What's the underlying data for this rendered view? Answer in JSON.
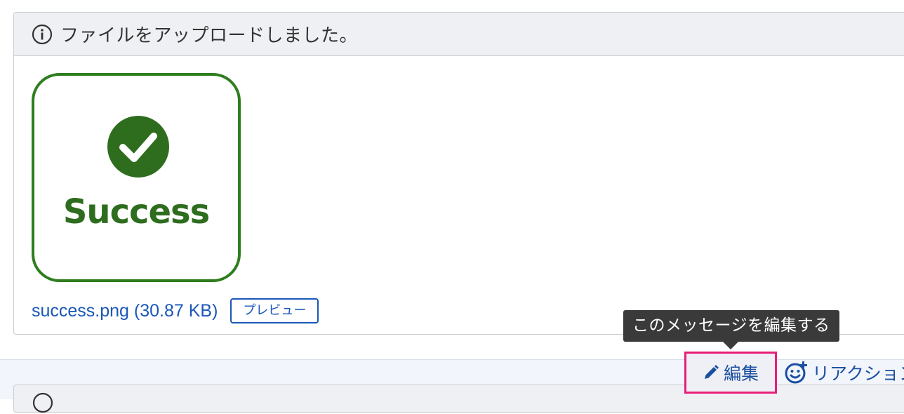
{
  "message": {
    "title": "ファイルをアップロードしました。",
    "attachment": {
      "thumbnail_text": "Success",
      "file_name": "success.png (30.87 KB)",
      "preview_label": "プレビュー"
    }
  },
  "actions": {
    "tooltip": "このメッセージを編集する",
    "edit_label": "編集",
    "reaction_label": "リアクション"
  },
  "colors": {
    "accent_blue": "#1a57b7",
    "success_green": "#2e7d1e",
    "highlight_pink": "#e91e78"
  }
}
